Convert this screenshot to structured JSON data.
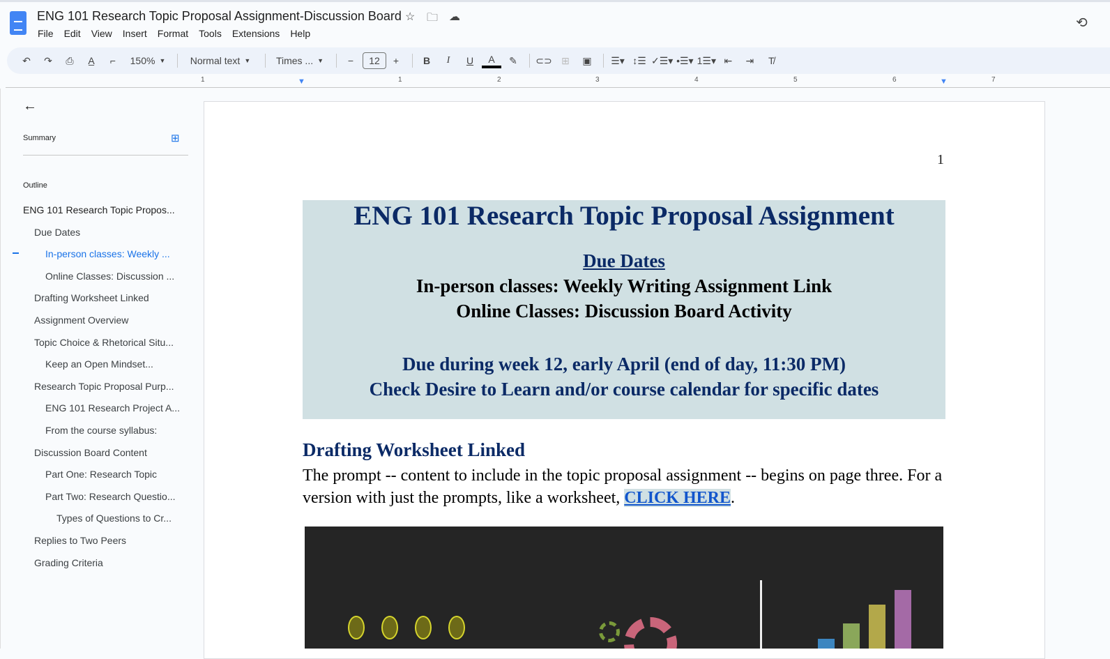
{
  "doc": {
    "title": "ENG 101 Research Topic Proposal Assignment-Discussion Board"
  },
  "menu": [
    "File",
    "Edit",
    "View",
    "Insert",
    "Format",
    "Tools",
    "Extensions",
    "Help"
  ],
  "toolbar": {
    "zoom": "150%",
    "style": "Normal text",
    "font": "Times ...",
    "font_size": "12"
  },
  "ruler": [
    "1",
    "1",
    "2",
    "3",
    "4",
    "5",
    "6",
    "7"
  ],
  "sidebar": {
    "summary": "Summary",
    "outline": "Outline",
    "items": [
      {
        "label": "ENG 101 Research Topic Propos...",
        "level": 0
      },
      {
        "label": "Due Dates",
        "level": 1
      },
      {
        "label": "In-person classes: Weekly ...",
        "level": 2,
        "active": true
      },
      {
        "label": "Online Classes: Discussion ...",
        "level": 2
      },
      {
        "label": "Drafting Worksheet Linked",
        "level": 1
      },
      {
        "label": "Assignment Overview",
        "level": 1
      },
      {
        "label": "Topic Choice & Rhetorical Situ...",
        "level": 1
      },
      {
        "label": "Keep an Open Mindset...",
        "level": 2
      },
      {
        "label": "Research Topic Proposal Purp...",
        "level": 1
      },
      {
        "label": "ENG 101 Research Project A...",
        "level": 2
      },
      {
        "label": "From the course syllabus:",
        "level": 2
      },
      {
        "label": "Discussion Board Content",
        "level": 1
      },
      {
        "label": "Part One: Research Topic",
        "level": 2
      },
      {
        "label": "Part Two: Research Questio...",
        "level": 2
      },
      {
        "label": "Types of Questions to Cr...",
        "level": 3
      },
      {
        "label": "Replies to Two Peers",
        "level": 1
      },
      {
        "label": "Grading Criteria",
        "level": 1
      }
    ]
  },
  "page": {
    "number": "1",
    "heading": "ENG 101 Research Topic Proposal Assignment",
    "due_dates": "Due Dates",
    "line1": "In-person classes: Weekly Writing Assignment Link",
    "line2": "Online Classes: Discussion Board Activity",
    "line3": "Due during week 12, early April (end of day, 11:30 PM)",
    "line4": "Check Desire to Learn and/or course calendar for specific dates",
    "h2": "Drafting Worksheet Linked",
    "para": "The prompt -- content to include in the topic proposal assignment -- begins on page three. For a version with just the prompts, like a worksheet,  ",
    "link": "CLICK HERE",
    "para_end": "."
  }
}
